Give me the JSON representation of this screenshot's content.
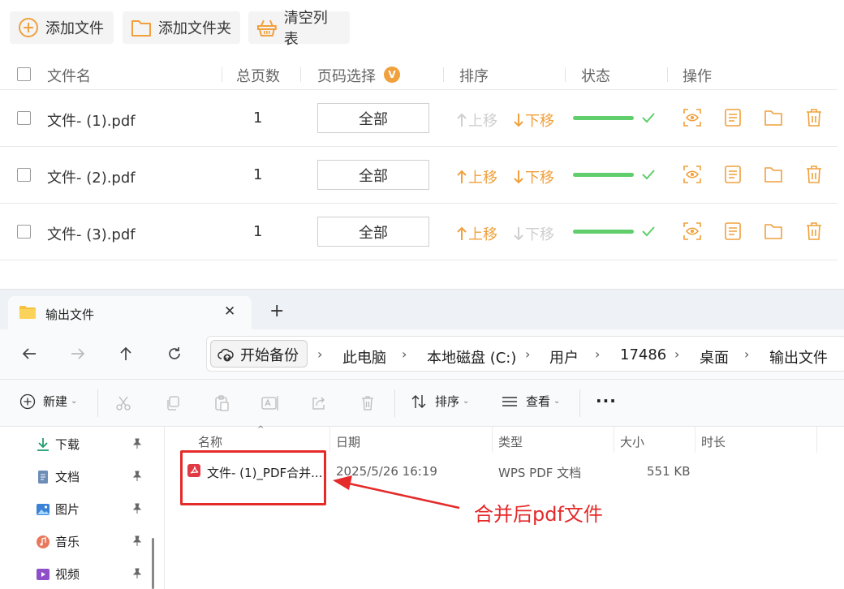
{
  "app": {
    "toolbar": {
      "add_file": "添加文件",
      "add_folder": "添加文件夹",
      "clear_list": "清空列表"
    },
    "columns": {
      "filename": "文件名",
      "total_pages": "总页数",
      "page_select": "页码选择",
      "page_select_badge": "V",
      "order": "排序",
      "status": "状态",
      "actions": "操作"
    },
    "rows": [
      {
        "name": "文件- (1).pdf",
        "pages": "1",
        "selection": "全部",
        "up": "上移",
        "down": "下移",
        "up_enabled": false,
        "down_enabled": true,
        "progress": 1.0
      },
      {
        "name": "文件- (2).pdf",
        "pages": "1",
        "selection": "全部",
        "up": "上移",
        "down": "下移",
        "up_enabled": true,
        "down_enabled": true,
        "progress": 1.0
      },
      {
        "name": "文件- (3).pdf",
        "pages": "1",
        "selection": "全部",
        "up": "上移",
        "down": "下移",
        "up_enabled": true,
        "down_enabled": false,
        "progress": 1.0
      }
    ],
    "colors": {
      "accent": "#f0a03c",
      "success": "#5fce6b",
      "disabled": "#cfcfcf"
    }
  },
  "explorer": {
    "tab_title": "输出文件",
    "tab_close": "✕",
    "new_tab": "+",
    "backup": "开始备份",
    "breadcrumbs": [
      "此电脑",
      "本地磁盘 (C:)",
      "用户",
      "17486",
      "桌面",
      "输出文件"
    ],
    "toolbar": {
      "new": "新建",
      "sort": "排序",
      "view": "查看",
      "more": "···"
    },
    "nav": [
      {
        "label": "下载",
        "icon": "download-icon"
      },
      {
        "label": "文档",
        "icon": "document-icon"
      },
      {
        "label": "图片",
        "icon": "picture-icon"
      },
      {
        "label": "音乐",
        "icon": "music-icon"
      },
      {
        "label": "视频",
        "icon": "video-icon"
      }
    ],
    "columns": {
      "name": "名称",
      "date": "日期",
      "type": "类型",
      "size": "大小",
      "duration": "时长"
    },
    "files": [
      {
        "name": "文件- (1)_PDF合并...",
        "date": "2025/5/26 16:19",
        "type": "WPS PDF 文档",
        "size": "551 KB"
      }
    ]
  },
  "annotation": {
    "text": "合并后pdf文件",
    "color": "#e52a2a"
  }
}
